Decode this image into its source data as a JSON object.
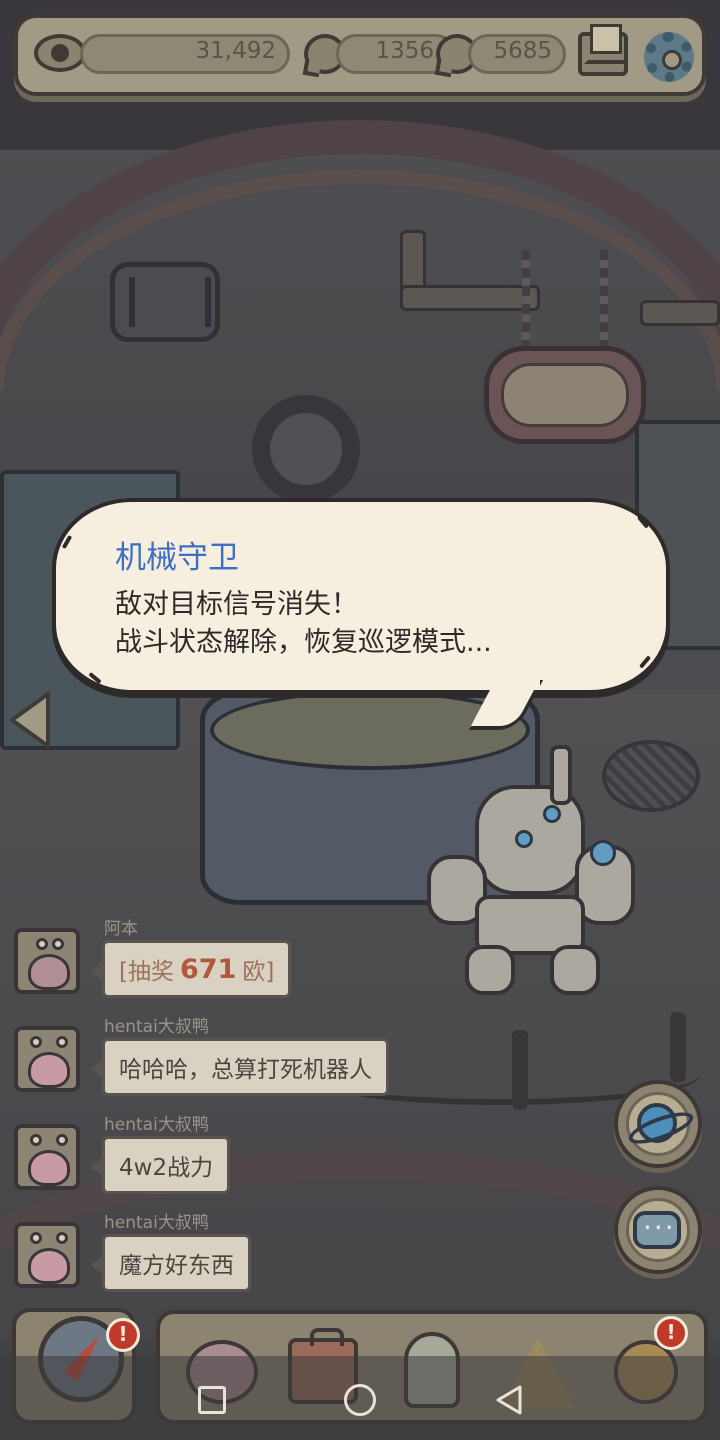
{
  "top_bar": {
    "views": "31,492",
    "messages": "1356",
    "replies": "5685"
  },
  "dialog": {
    "speaker": "机械守卫",
    "line1": "敌对目标信号消失！",
    "line2": "战斗状态解除，恢复巡逻模式..."
  },
  "chat": [
    {
      "sender": "阿本",
      "lottery_prefix": "[抽奖",
      "lottery_amount": "671",
      "lottery_suffix": "欧]"
    },
    {
      "sender": "hentai大叔鸭",
      "text": "哈哈哈，总算打死机器人"
    },
    {
      "sender": "hentai大叔鸭",
      "text": "4w2战力"
    },
    {
      "sender": "hentai大叔鸭",
      "text": "魔方好东西"
    }
  ],
  "badges": {
    "compass_alert": "!",
    "key_alert": "!"
  },
  "colors": {
    "speaker_name": "#3f6ec4",
    "lottery_amount": "#b0583c",
    "alert_badge": "#c0392b",
    "panel": "#a19a85"
  },
  "icons": [
    "eye-icon",
    "message-bubble-icon",
    "reply-bubble-icon",
    "mail-icon",
    "gear-icon",
    "left-arrow-icon",
    "planet-icon",
    "chat-icon",
    "compass-icon",
    "snail-icon",
    "bag-icon",
    "bust-icon",
    "pyramid-icon",
    "key-icon"
  ]
}
